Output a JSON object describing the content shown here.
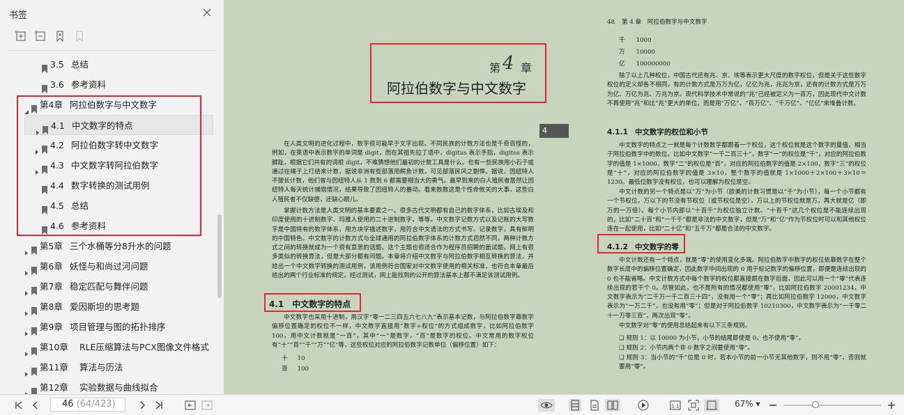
{
  "sidebar": {
    "title": "书签",
    "tools": [
      "expand-all-icon",
      "collapse-all-icon",
      "add-bookmark-icon",
      "bookmark-icon"
    ],
    "items": [
      {
        "level": 2,
        "num": "3.5",
        "label": "总结",
        "arrow": false,
        "selected": false
      },
      {
        "level": 2,
        "num": "3.6",
        "label": "参考资料",
        "arrow": false,
        "selected": false
      },
      {
        "level": 1,
        "num": "第4章",
        "label": "阿拉伯数字与中文数字",
        "arrow": "expanded",
        "selected": false
      },
      {
        "level": 2,
        "num": "4.1",
        "label": "中文数字的特点",
        "arrow": "collapsed",
        "selected": true
      },
      {
        "level": 2,
        "num": "4.2",
        "label": "阿拉伯数字转中文数字",
        "arrow": "collapsed",
        "selected": false
      },
      {
        "level": 2,
        "num": "4.3",
        "label": "中文数字转阿拉伯数字",
        "arrow": "collapsed",
        "selected": false
      },
      {
        "level": 2,
        "num": "4.4",
        "label": "数字转换的测试用例",
        "arrow": false,
        "selected": false
      },
      {
        "level": 2,
        "num": "4.5",
        "label": "总结",
        "arrow": false,
        "selected": false
      },
      {
        "level": 2,
        "num": "4.6",
        "label": "参考资料",
        "arrow": false,
        "selected": false
      },
      {
        "level": 1,
        "num": "第5章",
        "label": "三个水桶等分8升水的问题",
        "arrow": "collapsed",
        "selected": false
      },
      {
        "level": 1,
        "num": "第6章",
        "label": "妖怪与和尚过河问题",
        "arrow": "collapsed",
        "selected": false
      },
      {
        "level": 1,
        "num": "第7章",
        "label": "稳定匹配与舞伴问题",
        "arrow": "collapsed",
        "selected": false
      },
      {
        "level": 1,
        "num": "第8章",
        "label": "爱因斯坦的思考题",
        "arrow": "collapsed",
        "selected": false
      },
      {
        "level": 1,
        "num": "第9章",
        "label": "项目管理与图的拓扑排序",
        "arrow": "collapsed",
        "selected": false
      },
      {
        "level": 1,
        "num": "第10章",
        "label": "RLE压缩算法与PCX图像文件格式",
        "arrow": "collapsed",
        "selected": false
      },
      {
        "level": 1,
        "num": "第11章",
        "label": "算法与历法",
        "arrow": "collapsed",
        "selected": false
      },
      {
        "level": 1,
        "num": "第12章",
        "label": "实验数据与曲线拟合",
        "arrow": "collapsed",
        "selected": false
      }
    ]
  },
  "left_page": {
    "chapter_prefix": "第",
    "chapter_num": "4",
    "chapter_suffix": "章",
    "chapter_title": "阿拉伯数字与中文数字",
    "tab_num": "4",
    "p1": "在人类文明的进化过程中，数字很可能早于文字出现。不同民族的计数方法也是千奇百怪的，例如，在英语中表示数字的单词是 digit，而在其祖先拉丁语中，digitus 表示手指，digitos 表示脚趾，根据它们共有的词根 digit，不难猜想他们最初的计数工具是什么。也有一些民族用小石子或通过在绳子上打结来计数，据说非洲有些部落用鳄鱼计数，可见部落民风之剽悍。据说，因纽特人不擅长计数，他们曾与因纽特人从 1 数到 6 都需要相当大的勇气。最早到来的白人殖民者居然让因纽特人每天统计捕猎情况，结果导致了因纽特人的暴动。看来数数这是个性命攸关的大事，这些白人殖民者不仅缺德，还缺心眼儿。",
    "p2": "掌握计数方法是人类文明的基本要素之一。很多古代文明都有自己的数字体系，比如古埃及和印度使用的十进制数字、玛雅人使用的二十进制数字，等等。中文数字记数方式以及记账的大写数字是中国特有的数字体系，用方块字描述数字，用符合中文语法的方式书写、记录数字，具有鲜明的中国特色。中文数字的计数方式与全球通用的阿拉伯数字体系的计数方式迥然不同，两种计数方式之间的转换就成为一个很有意思的话题。这个主题也很适合作为程序员招聘的面试题，网上有很多类似的转换算法，但是大部分都有问题。本章将介绍中文数字与阿拉伯数字相互转换的算法，并给出一个中文数字转换的测试用例，该用例符合国家对中文数字使用的相关标准，也符合本章最后给出的两个行业标准的规定。经过测试，网上能找到的公开的算法基本上都不满足该测试用例。",
    "section_num": "4.1",
    "section_title": "中文数字的特点",
    "p3": "中文数字也采用十进制，用汉字“零一二三四五六七八九”表示基本记数，与阿拉伯数字靠数字偏移位置确定的权位不一样，中文数字直接用“数字+权位”的方式组成数字，比如阿拉伯数字 100，用中文计数就是“一百”，其中“一”是数字，“百”是数字的权位。中文常用的数字权位有“十”“百”“千”“万”“亿”等，这些权位对应的阿拉伯数字记数单位（偏移位置）如下：",
    "units": [
      {
        "zh": "十",
        "num": "10"
      },
      {
        "zh": "百",
        "num": "100"
      }
    ]
  },
  "right_page": {
    "page_no": "48",
    "running_head": "第 4 章　阿拉伯数字与中文数字",
    "units": [
      {
        "zh": "千",
        "num": "1000"
      },
      {
        "zh": "万",
        "num": "10000"
      },
      {
        "zh": "亿",
        "num": "100000000"
      }
    ],
    "p1": "除了以上几种权位，中国古代还有兆、京、垓等表示更大尺度的数字权位，但是关于这些数字权位的定义却各不相同，有的计数方式是万万为亿，亿亿为兆，兆兆为京，还有的计数方式是万万为亿、万亿为兆、万兆为京。现代科学技术中常说的“兆”已经被定义为一百万，因此现代中文计数不再使用“兆”和比“兆”更大的单位，而是用“万亿”、“百万亿”、“千万亿”、“亿亿”来堆叠计数。",
    "s1_num": "4.1.1",
    "s1_title": "中文数字的权位和小节",
    "p2": "中文数字的特点之一就是每个计数数字都跟着一个权位，这个权位就是这个数字的量值，相当于阿拉伯数字中的数位。比如中文数字“一千二百三十”，数字“一”的权位是“千”，对应的阿拉伯数字的值是 1×1000，数字“二”的权位是“百”，对应的阿拉伯数字的值是 2×100，数字“三”的权位是“十”，对应的阿拉伯数字的值是 3×10，整个数字的值就是 1×1000＋2×100＋3×10＝1230。最低位数字没有权位，也可以理解为权位是空。",
    "p3": "中文计数的另一个特点是以“万”为小节（欧美的计数习惯是以“千”为小节），每一个小节都有一个节权位，万以下的节没有节权位（或节权位是空），万以上的节权位就是万，再大就是亿（即万的一万倍）。每个小节内部以“十百千”为权位独立计数。“十百千”这几个权位是不能连续出现的，比如“二十百”和“一千千”都是非法的中文数字，但是“万”和“亿”作为节权位时可以和其他权位连在一起使用，比如“二十亿”和“五千万”都是合法的中文数字。",
    "s2_num": "4.1.2",
    "s2_title": "中文数字的零",
    "p4": "中文计数还有一个特点，就是“零”的使用变化多端。阿拉伯数字中数字的权位依靠数字在整个数字长度中的偏移位置确定，因此数字中间出现的 0 用于标记数字的偏移位置，即便是连续出现的 0 也不能省略。中文计数方式中每个数字的权位都直接跟在数字后面，因此可以用一个“零”代表连续出现的若干个 0。尽管如此，也不是所有的情况都使用“零”，比如阿拉伯数字 20001234，中文数字表示为“二千万一千二百三十四”，没有用一个“零”；再比如阿拉伯数字 12000，中文数字表示为“一万二千”，也没有用“零”；但是对于阿拉伯数字 10210300，中文数字表示为“一千零二十一万零三百”，两次出现“零”。",
    "p5": "中文数字对“零”的使用总结起来有以下三条规则。",
    "rules": [
      "规则 1：以 10000 为小节，小节的结尾即使是 0，也不使用“零”。",
      "规则 2：小节内两个非 0 数字之间要使用“零”。",
      "规则 3：当小节的“千”位是 0 时，若本小节的前一小节无其他数字，则不用“零”，否则就要用“零”。"
    ]
  },
  "bottom": {
    "page_current": "46",
    "page_total": "(64/423)",
    "zoom": "67%",
    "zoom_level": 0.33
  },
  "colors": {
    "highlight_box": "#e0282e",
    "page_bg": "#c7d5bd",
    "sidebar_bg": "#f2f2f2",
    "tab_bg": "#555555"
  }
}
